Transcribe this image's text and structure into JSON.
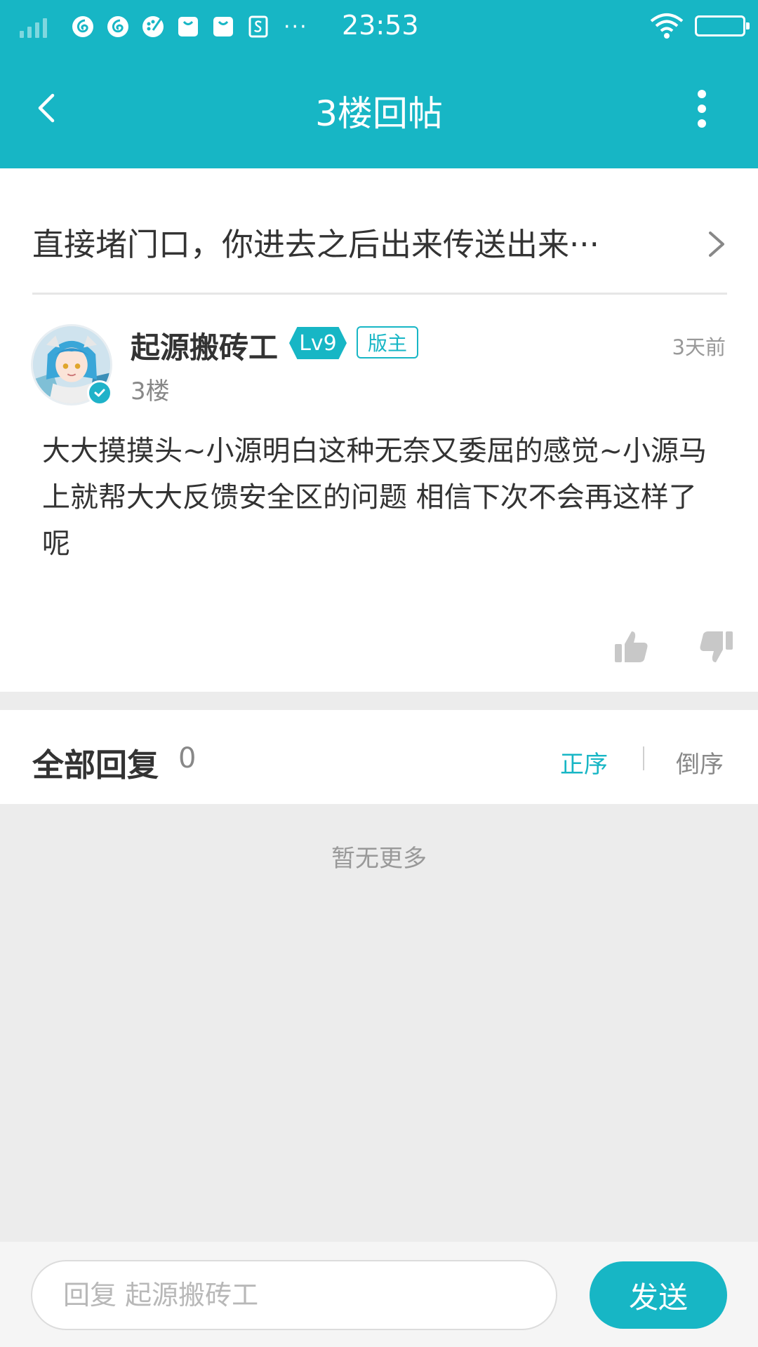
{
  "status_bar": {
    "time": "23:53",
    "more": "···",
    "icons": [
      "netease-music-icon",
      "netease-music-icon",
      "paint-palette-icon",
      "shopping-bag-icon",
      "shopping-bag-icon",
      "s-app-icon"
    ]
  },
  "header": {
    "title": "3楼回帖"
  },
  "thread": {
    "quote": "直接堵门口，你进去之后出来传送出来···"
  },
  "post": {
    "username": "起源搬砖工",
    "level": "Lv9",
    "role": "版主",
    "floor": "3楼",
    "time": "3天前",
    "content": "大大摸摸头~小源明白这种无奈又委屈的感觉~小源马上就帮大大反馈安全区的问题 相信下次不会再这样了呢"
  },
  "replies": {
    "title": "全部回复",
    "count": "0",
    "sort_asc": "正序",
    "sort_desc": "倒序",
    "empty_text": "暂无更多"
  },
  "reply_bar": {
    "placeholder": "回复 起源搬砖工",
    "send_label": "发送"
  },
  "colors": {
    "accent": "#17b6c5",
    "background": "#ececec"
  }
}
